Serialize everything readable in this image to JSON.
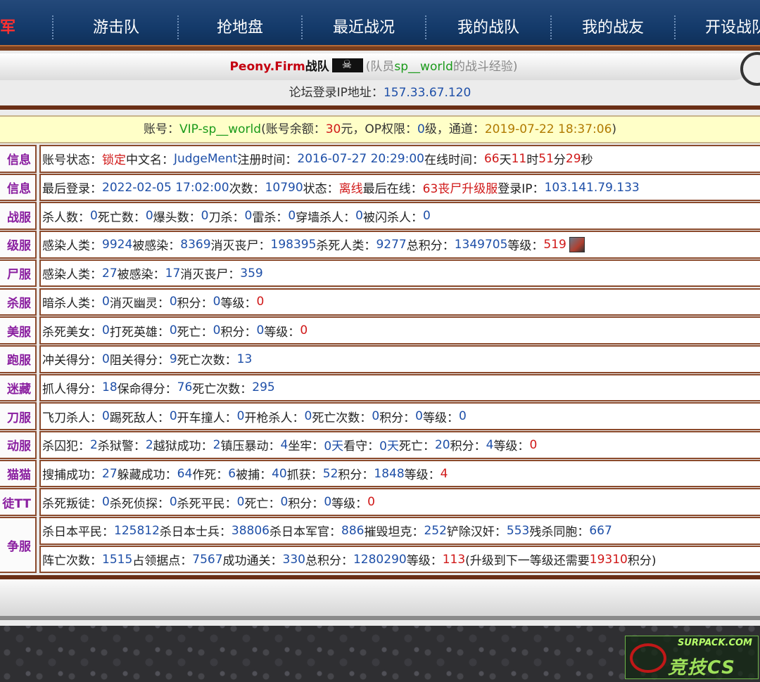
{
  "nav": {
    "items": [
      {
        "label": "军"
      },
      {
        "label": "游击队"
      },
      {
        "label": "抢地盘"
      },
      {
        "label": "最近战况"
      },
      {
        "label": "我的战队"
      },
      {
        "label": "我的战友"
      },
      {
        "label": "开设战队"
      }
    ]
  },
  "header": {
    "team_name": "Peony.Firm",
    "team_suffix": "战队",
    "desc_prefix": "(队员",
    "member": "sp__world",
    "desc_suffix": "的战斗经验)",
    "ip_label": "论坛登录IP地址：",
    "ip_value": "157.33.67.120"
  },
  "account": {
    "label": "账号：",
    "account_name": "VIP-sp__world",
    "balance_label": "(账号余额：",
    "balance": "30",
    "balance_unit": "元，OP权限：",
    "op_level": "0",
    "channel_label": "级，通道：",
    "channel_date": "2019-07-22 18:37:06",
    "close": ")"
  },
  "rows": [
    {
      "label": "信息",
      "segments": [
        {
          "t": "账号状态："
        },
        {
          "t": "锁定",
          "c": "red"
        },
        {
          "t": " 中文名："
        },
        {
          "t": "JudgeMent",
          "c": "blue"
        },
        {
          "t": " 注册时间："
        },
        {
          "t": "2016-07-27 20:29:00",
          "c": "blue"
        },
        {
          "t": " 在线时间："
        },
        {
          "t": "66",
          "c": "red"
        },
        {
          "t": "天"
        },
        {
          "t": "11",
          "c": "red"
        },
        {
          "t": "时"
        },
        {
          "t": "51",
          "c": "red"
        },
        {
          "t": "分"
        },
        {
          "t": "29",
          "c": "red"
        },
        {
          "t": "秒"
        }
      ]
    },
    {
      "label": "信息",
      "segments": [
        {
          "t": "最后登录："
        },
        {
          "t": "2022-02-05 17:02:00",
          "c": "blue"
        },
        {
          "t": " 次数："
        },
        {
          "t": "10790",
          "c": "blue"
        },
        {
          "t": " 状态："
        },
        {
          "t": "离线",
          "c": "red"
        },
        {
          "t": " 最后在线："
        },
        {
          "t": "63丧尸升级服",
          "c": "red"
        },
        {
          "t": " 登录IP："
        },
        {
          "t": "103.141.79.133",
          "c": "blue"
        }
      ]
    },
    {
      "label": "战服",
      "segments": [
        {
          "t": "杀人数："
        },
        {
          "t": "0",
          "c": "blue"
        },
        {
          "t": " 死亡数："
        },
        {
          "t": "0",
          "c": "blue"
        },
        {
          "t": " 爆头数："
        },
        {
          "t": "0",
          "c": "blue"
        },
        {
          "t": " 刀杀："
        },
        {
          "t": "0",
          "c": "blue"
        },
        {
          "t": " 雷杀："
        },
        {
          "t": "0",
          "c": "blue"
        },
        {
          "t": " 穿墙杀人："
        },
        {
          "t": "0",
          "c": "blue"
        },
        {
          "t": " 被闪杀人："
        },
        {
          "t": "0",
          "c": "blue"
        }
      ]
    },
    {
      "label": "级服",
      "avatar": true,
      "segments": [
        {
          "t": "感染人类："
        },
        {
          "t": "9924",
          "c": "blue"
        },
        {
          "t": " 被感染："
        },
        {
          "t": "8369",
          "c": "blue"
        },
        {
          "t": " 消灭丧尸："
        },
        {
          "t": "198395",
          "c": "blue"
        },
        {
          "t": " 杀死人类："
        },
        {
          "t": "9277",
          "c": "blue"
        },
        {
          "t": " 总积分："
        },
        {
          "t": "1349705",
          "c": "blue"
        },
        {
          "t": " 等级："
        },
        {
          "t": "519",
          "c": "red"
        }
      ]
    },
    {
      "label": "尸服",
      "segments": [
        {
          "t": "感染人类："
        },
        {
          "t": "27",
          "c": "blue"
        },
        {
          "t": " 被感染："
        },
        {
          "t": "17",
          "c": "blue"
        },
        {
          "t": " 消灭丧尸："
        },
        {
          "t": "359",
          "c": "blue"
        }
      ]
    },
    {
      "label": "杀服",
      "segments": [
        {
          "t": "暗杀人类："
        },
        {
          "t": "0",
          "c": "blue"
        },
        {
          "t": " 消灭幽灵："
        },
        {
          "t": "0",
          "c": "blue"
        },
        {
          "t": " 积分："
        },
        {
          "t": "0",
          "c": "blue"
        },
        {
          "t": " 等级："
        },
        {
          "t": "0",
          "c": "red"
        }
      ]
    },
    {
      "label": "美服",
      "segments": [
        {
          "t": "杀死美女："
        },
        {
          "t": "0",
          "c": "blue"
        },
        {
          "t": " 打死英雄："
        },
        {
          "t": "0",
          "c": "blue"
        },
        {
          "t": " 死亡："
        },
        {
          "t": "0",
          "c": "blue"
        },
        {
          "t": " 积分："
        },
        {
          "t": "0",
          "c": "blue"
        },
        {
          "t": " 等级："
        },
        {
          "t": "0",
          "c": "red"
        }
      ]
    },
    {
      "label": "跑服",
      "segments": [
        {
          "t": "冲关得分："
        },
        {
          "t": "0",
          "c": "blue"
        },
        {
          "t": " 阻关得分："
        },
        {
          "t": "9",
          "c": "blue"
        },
        {
          "t": " 死亡次数："
        },
        {
          "t": "13",
          "c": "blue"
        }
      ]
    },
    {
      "label": "迷藏",
      "segments": [
        {
          "t": "抓人得分："
        },
        {
          "t": "18",
          "c": "blue"
        },
        {
          "t": " 保命得分："
        },
        {
          "t": "76",
          "c": "blue"
        },
        {
          "t": " 死亡次数："
        },
        {
          "t": "295",
          "c": "blue"
        }
      ]
    },
    {
      "label": "刀服",
      "segments": [
        {
          "t": "飞刀杀人："
        },
        {
          "t": "0",
          "c": "blue"
        },
        {
          "t": " 踢死敌人："
        },
        {
          "t": "0",
          "c": "blue"
        },
        {
          "t": " 开车撞人："
        },
        {
          "t": "0",
          "c": "blue"
        },
        {
          "t": " 开枪杀人："
        },
        {
          "t": "0",
          "c": "blue"
        },
        {
          "t": " 死亡次数："
        },
        {
          "t": "0",
          "c": "blue"
        },
        {
          "t": " 积分："
        },
        {
          "t": "0",
          "c": "blue"
        },
        {
          "t": " 等级："
        },
        {
          "t": "0",
          "c": "blue"
        }
      ]
    },
    {
      "label": "动服",
      "segments": [
        {
          "t": "杀囚犯："
        },
        {
          "t": "2",
          "c": "blue"
        },
        {
          "t": " 杀狱警："
        },
        {
          "t": "2",
          "c": "blue"
        },
        {
          "t": " 越狱成功："
        },
        {
          "t": "2",
          "c": "blue"
        },
        {
          "t": " 镇压暴动："
        },
        {
          "t": "4",
          "c": "blue"
        },
        {
          "t": " 坐牢："
        },
        {
          "t": "0天",
          "c": "blue"
        },
        {
          "t": " 看守："
        },
        {
          "t": "0天",
          "c": "blue"
        },
        {
          "t": " 死亡："
        },
        {
          "t": "20",
          "c": "blue"
        },
        {
          "t": " 积分："
        },
        {
          "t": "4",
          "c": "blue"
        },
        {
          "t": " 等级："
        },
        {
          "t": "0",
          "c": "red"
        }
      ]
    },
    {
      "label": "猫猫",
      "segments": [
        {
          "t": "搜捕成功："
        },
        {
          "t": "27",
          "c": "blue"
        },
        {
          "t": " 躲藏成功："
        },
        {
          "t": "64",
          "c": "blue"
        },
        {
          "t": " 作死："
        },
        {
          "t": "6",
          "c": "blue"
        },
        {
          "t": " 被捕："
        },
        {
          "t": "40",
          "c": "blue"
        },
        {
          "t": " 抓获："
        },
        {
          "t": "52",
          "c": "blue"
        },
        {
          "t": " 积分："
        },
        {
          "t": "1848",
          "c": "blue"
        },
        {
          "t": " 等级："
        },
        {
          "t": "4",
          "c": "red"
        }
      ]
    },
    {
      "label": "徒TT",
      "segments": [
        {
          "t": "杀死叛徒："
        },
        {
          "t": "0",
          "c": "blue"
        },
        {
          "t": " 杀死侦探："
        },
        {
          "t": "0",
          "c": "blue"
        },
        {
          "t": " 杀死平民："
        },
        {
          "t": "0",
          "c": "blue"
        },
        {
          "t": " 死亡："
        },
        {
          "t": "0",
          "c": "blue"
        },
        {
          "t": " 积分："
        },
        {
          "t": "0",
          "c": "blue"
        },
        {
          "t": " 等级："
        },
        {
          "t": "0",
          "c": "red"
        }
      ]
    }
  ],
  "war_row": {
    "label": "争服",
    "line1": [
      {
        "t": "杀日本平民："
      },
      {
        "t": "125812",
        "c": "blue"
      },
      {
        "t": " 杀日本士兵："
      },
      {
        "t": "38806",
        "c": "blue"
      },
      {
        "t": " 杀日本军官："
      },
      {
        "t": "886",
        "c": "blue"
      },
      {
        "t": " 摧毁坦克："
      },
      {
        "t": "252",
        "c": "blue"
      },
      {
        "t": " 铲除汉奸："
      },
      {
        "t": "553",
        "c": "blue"
      },
      {
        "t": " 残杀同胞："
      },
      {
        "t": "667",
        "c": "blue"
      }
    ],
    "line2": [
      {
        "t": "阵亡次数："
      },
      {
        "t": "1515",
        "c": "blue"
      },
      {
        "t": " 占领据点："
      },
      {
        "t": "7567",
        "c": "blue"
      },
      {
        "t": " 成功通关："
      },
      {
        "t": "330",
        "c": "blue"
      },
      {
        "t": " 总积分："
      },
      {
        "t": "1280290",
        "c": "blue"
      },
      {
        "t": " 等级："
      },
      {
        "t": "113",
        "c": "red"
      },
      {
        "t": " (升级到下一等级还需要"
      },
      {
        "t": "19310",
        "c": "red"
      },
      {
        "t": "积分)"
      }
    ]
  },
  "watermark": {
    "top": "SURPACK.COM",
    "bottom": "竞技CS"
  }
}
